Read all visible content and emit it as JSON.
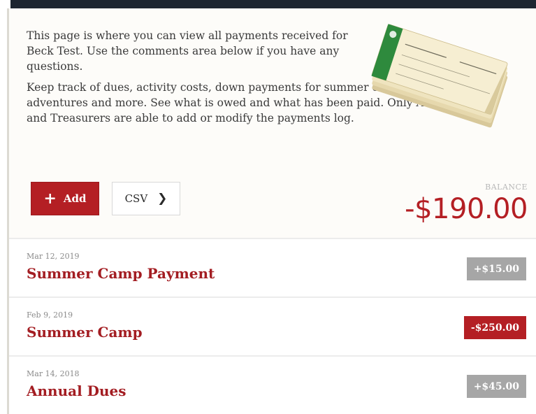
{
  "intro": {
    "paragraph1": "This page is where you can view all payments received for Beck Test. Use the comments area below if you have any questions.",
    "paragraph2": "Keep track of dues, activity costs, down payments for summer camps or high adventures and more. See what is owed and what has been paid. Only Admins and Treasurers are able to add or modify the payments log."
  },
  "toolbar": {
    "add_label": "Add",
    "add_icon": "plus-icon",
    "csv_label": "CSV",
    "csv_icon": "chevron-right-icon"
  },
  "balance": {
    "label": "BALANCE",
    "value": "-$190.00"
  },
  "payments": [
    {
      "date": "Mar 12, 2019",
      "title": "Summer Camp Payment",
      "amount": "+$15.00",
      "type": "positive"
    },
    {
      "date": "Feb 9, 2019",
      "title": "Summer Camp",
      "amount": "-$250.00",
      "type": "negative"
    },
    {
      "date": "Mar 14, 2018",
      "title": "Annual Dues",
      "amount": "+$45.00",
      "type": "positive"
    }
  ],
  "colors": {
    "accent": "#b41f24",
    "header_bar": "#1d2531",
    "positive_badge": "#a6a6a6",
    "negative_badge": "#b41f24"
  }
}
